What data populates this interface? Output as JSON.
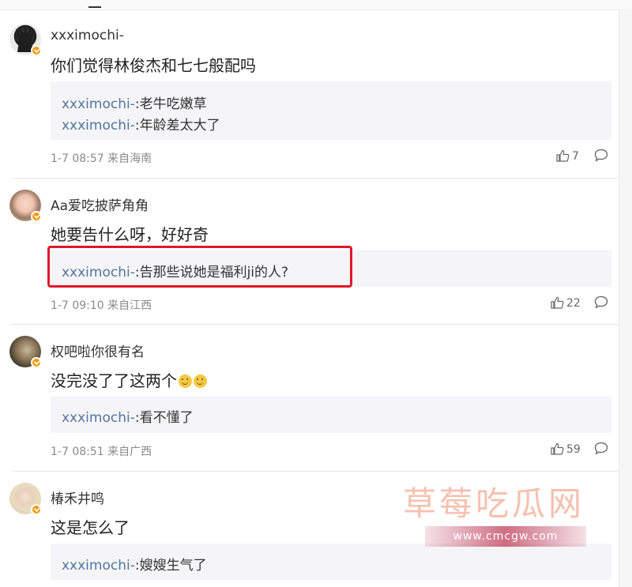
{
  "comments": [
    {
      "username": "xxximochi-",
      "content": "你们觉得林俊杰和七七般配吗",
      "replies": [
        {
          "user": "xxximochi-",
          "text": ":老牛吃嫩草"
        },
        {
          "user": "xxximochi-",
          "text": ":年龄差太大了"
        }
      ],
      "time": "1-7 08:57 来自海南",
      "likes": "7",
      "avatar_icon": "dark-character-avatar"
    },
    {
      "username": "Aa爱吃披萨角角",
      "content": "她要告什么呀，好好奇",
      "replies": [
        {
          "user": "xxximochi-",
          "text": ":告那些说她是福利ji的人?"
        }
      ],
      "time": "1-7 09:10 来自江西",
      "likes": "22",
      "avatar_icon": "girl-photo-avatar"
    },
    {
      "username": "权吧啦你很有名",
      "content": "没完没了了这两个",
      "replies": [
        {
          "user": "xxximochi-",
          "text": ":看不懂了"
        }
      ],
      "time": "1-7 08:51 来自广西",
      "likes": "59",
      "avatar_icon": "blurred-photo-avatar"
    },
    {
      "username": "椿禾井鸣",
      "content": "这是怎么了",
      "replies": [
        {
          "user": "xxximochi-",
          "text": ":嫂嫂生气了"
        }
      ],
      "avatar_icon": "blonde-girl-avatar"
    }
  ],
  "watermark": {
    "title": "草莓吃瓜网",
    "url": "www.cmcgw.com"
  },
  "colors": {
    "reply_user": "#51759e",
    "highlight_border": "#e3162a",
    "verified_badge": "#f39c12",
    "reply_bg": "#f5f5f7"
  }
}
